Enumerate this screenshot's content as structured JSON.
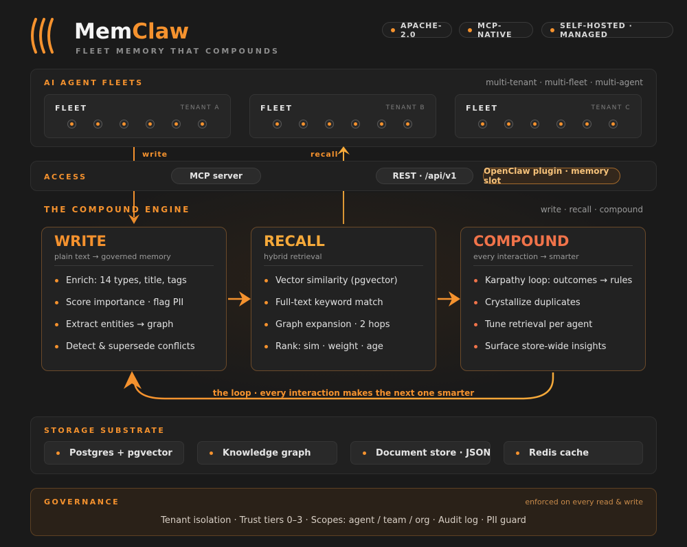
{
  "header": {
    "brand_a": "Mem",
    "brand_b": "Claw",
    "tagline": "FLEET MEMORY THAT COMPOUNDS",
    "badges": [
      "APACHE-2.0",
      "MCP-NATIVE",
      "SELF-HOSTED · MANAGED"
    ]
  },
  "fleets": {
    "title": "AI AGENT FLEETS",
    "meta": "multi-tenant · multi-fleet · multi-agent",
    "cards": [
      {
        "label": "FLEET",
        "tenant": "TENANT A"
      },
      {
        "label": "FLEET",
        "tenant": "TENANT B"
      },
      {
        "label": "FLEET",
        "tenant": "TENANT C"
      }
    ],
    "agents_per_fleet": 6
  },
  "flow": {
    "write": "write",
    "recall": "recall"
  },
  "access": {
    "title": "ACCESS",
    "items": [
      "MCP server",
      "REST · /api/v1",
      "OpenClaw plugin · memory slot"
    ]
  },
  "engine": {
    "title": "THE COMPOUND ENGINE",
    "meta": "write · recall · compound",
    "cards": [
      {
        "title": "WRITE",
        "subtitle": "plain text → governed memory",
        "items": [
          "Enrich: 14 types, title, tags",
          "Score importance · flag PII",
          "Extract entities → graph",
          "Detect & supersede conflicts"
        ]
      },
      {
        "title": "RECALL",
        "subtitle": "hybrid retrieval",
        "items": [
          "Vector similarity (pgvector)",
          "Full-text keyword match",
          "Graph expansion · 2 hops",
          "Rank: sim · weight · age"
        ]
      },
      {
        "title": "COMPOUND",
        "subtitle": "every interaction → smarter",
        "items": [
          "Karpathy loop: outcomes → rules",
          "Crystallize duplicates",
          "Tune retrieval per agent",
          "Surface store-wide insights"
        ]
      }
    ],
    "loop_label": "the loop · every interaction makes the next one smarter"
  },
  "storage": {
    "title": "STORAGE SUBSTRATE",
    "items": [
      "Postgres + pgvector",
      "Knowledge graph",
      "Document store · JSONB",
      "Redis cache"
    ]
  },
  "governance": {
    "title": "GOVERNANCE",
    "meta": "enforced on every read & write",
    "body": "Tenant isolation · Trust tiers 0–3 · Scopes: agent / team / org · Audit log · PII guard"
  },
  "colors": {
    "accent": "#f5922e",
    "recall": "#f5a93a",
    "compound": "#f0734a",
    "background": "#1a1a1a",
    "governance_bg": "#2a2118"
  },
  "icons": [
    "logo-waves-icon",
    "arrow-right-icon",
    "arrow-up-icon",
    "arrow-down-icon",
    "loop-arrow-icon"
  ]
}
